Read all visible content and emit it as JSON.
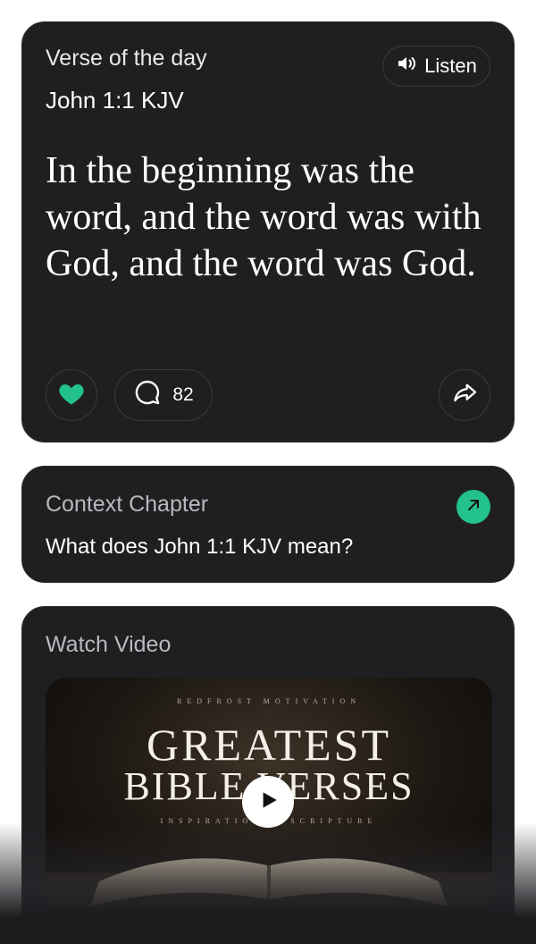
{
  "verse_card": {
    "label": "Verse of the day",
    "reference": "John 1:1 KJV",
    "listen_label": "Listen",
    "text": "In the beginning was the word, and the word was with God, and the word was God.",
    "comment_count": "82",
    "like_color": "#22c28a"
  },
  "context_card": {
    "title": "Context Chapter",
    "question": "What does John 1:1 KJV mean?",
    "accent": "#22c28a"
  },
  "video_card": {
    "title": "Watch Video",
    "thumbnail": {
      "top_text": "REDFROST MOTIVATION",
      "line1": "GREATEST",
      "line2": "BIBLE VERSES",
      "bottom_text": "INSPIRATIONAL SCRIPTURE"
    }
  },
  "icons": {
    "listen": "speaker-icon",
    "like": "heart-icon",
    "comment": "comment-icon",
    "share": "share-icon",
    "context": "arrow-up-right-icon",
    "play": "play-icon"
  }
}
